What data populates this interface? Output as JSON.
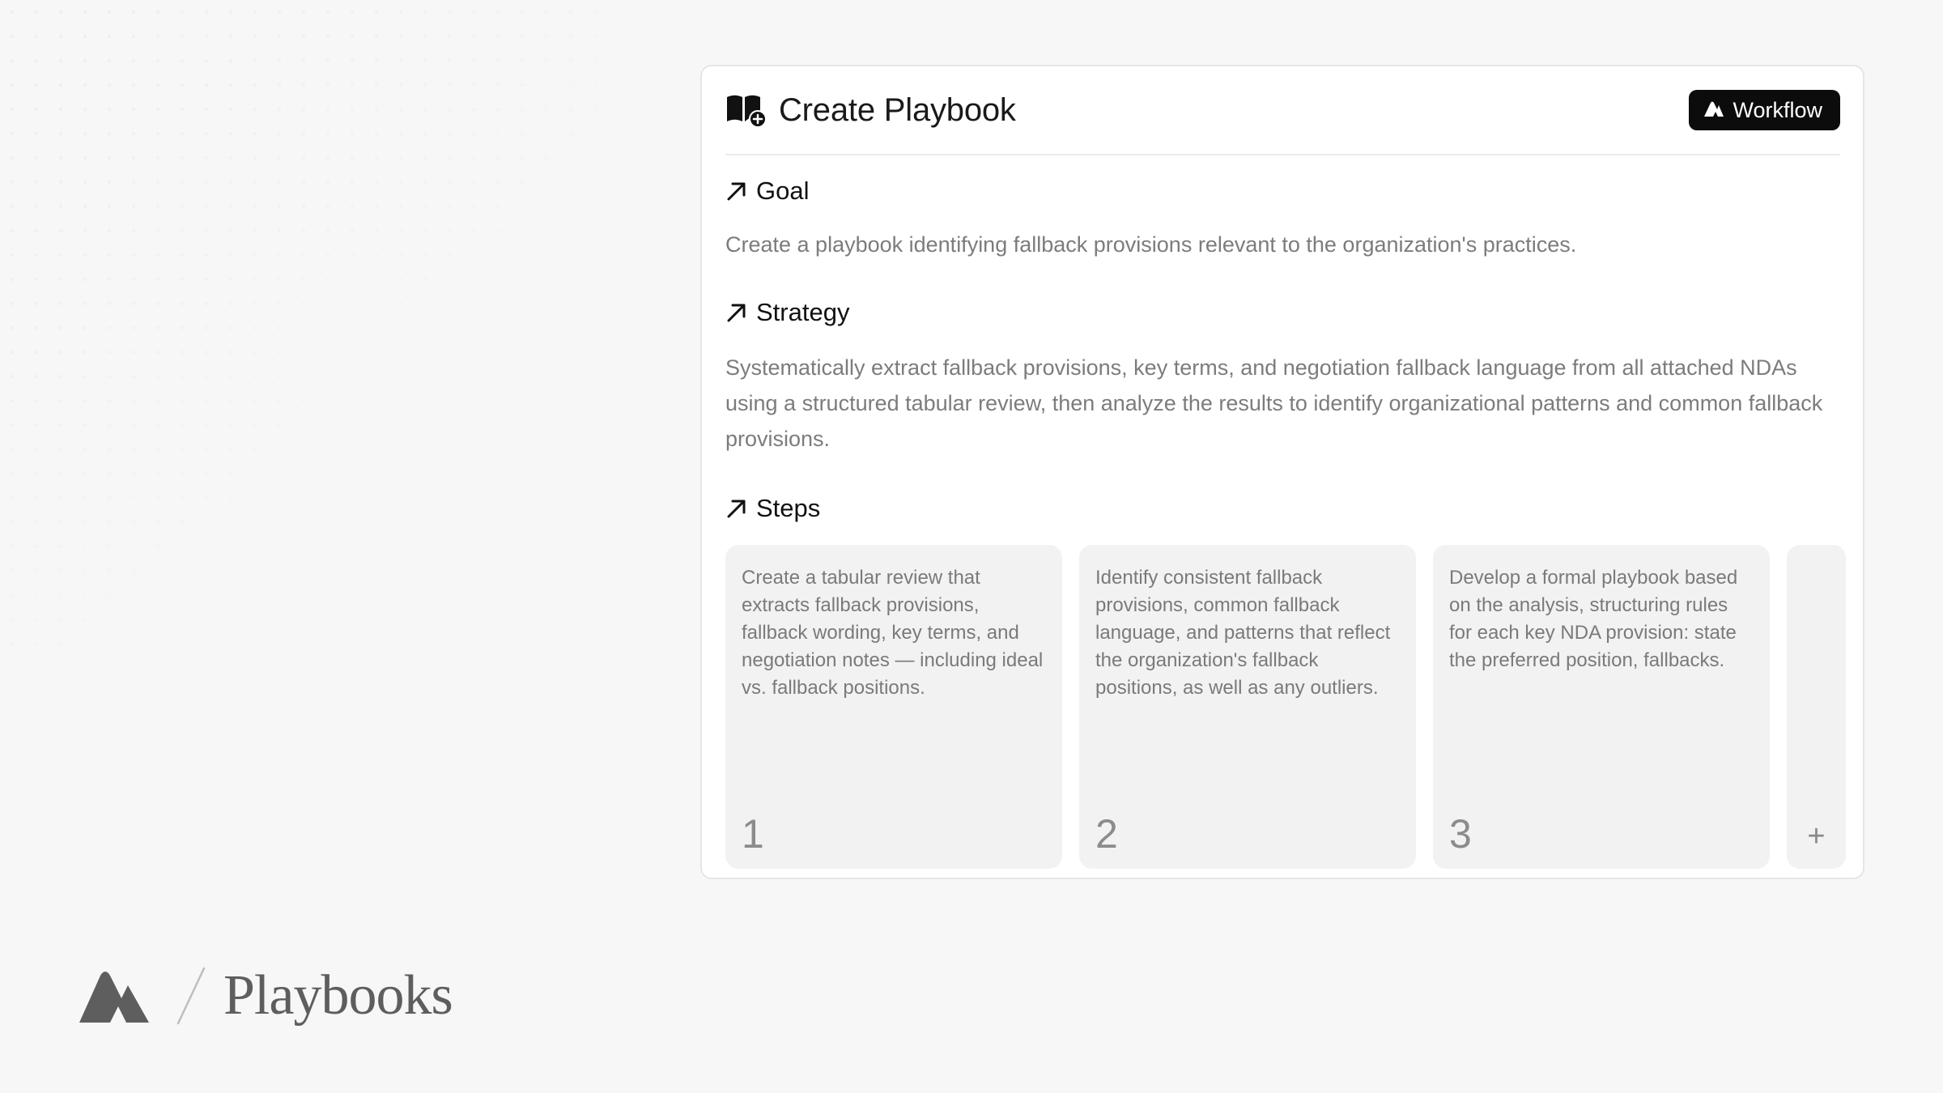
{
  "card": {
    "title": "Create Playbook",
    "workflow_label": "Workflow"
  },
  "goal": {
    "heading": "Goal",
    "text": "Create a playbook identifying fallback provisions relevant to the organization's practices."
  },
  "strategy": {
    "heading": "Strategy",
    "text": "Systematically extract fallback provisions, key terms, and negotiation fallback language from all attached NDAs using a structured tabular review, then analyze the results to identify organizational patterns and common fallback provisions."
  },
  "steps": {
    "heading": "Steps",
    "items": [
      {
        "text": "Create a tabular review that extracts fallback provisions, fallback wording, key terms, and negotiation notes — including ideal vs. fallback positions.",
        "number": "1"
      },
      {
        "text": "Identify consistent fallback provisions, common fallback language, and patterns that reflect the organization's fallback positions, as well as any outliers.",
        "number": "2"
      },
      {
        "text": "Develop a formal playbook based on the analysis, structuring rules for each key NDA provision: state the preferred position, fallbacks.",
        "number": "3"
      }
    ],
    "add_label": "+"
  },
  "brand": {
    "name": "Playbooks"
  },
  "icons": {
    "header": "book-plus-icon",
    "workflow": "harvey-logo-icon",
    "section": "arrow-up-right-icon",
    "brand": "harvey-logo-icon"
  },
  "colors": {
    "background": "#f7f7f7",
    "card": "#ffffff",
    "button": "#0c0c0c",
    "muted_text": "#7c7c7c",
    "step_card": "#f2f2f2"
  }
}
